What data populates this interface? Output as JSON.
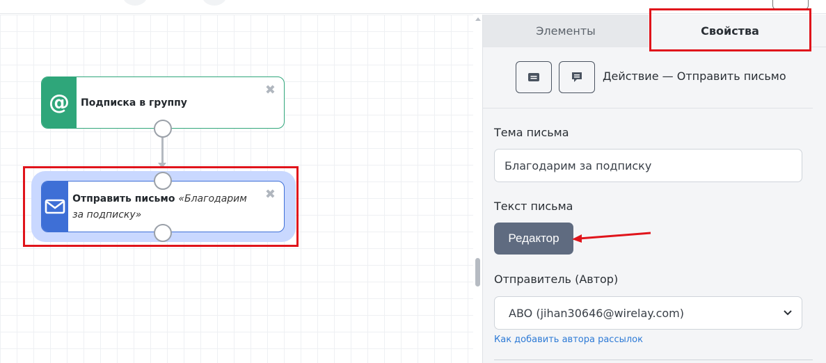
{
  "canvas": {
    "nodes": [
      {
        "label": "Подписка в группу",
        "icon": "at-icon",
        "color": "#2fa67a"
      },
      {
        "label": "Отправить письмо",
        "subtitle": "«Благодарим за подписку»",
        "icon": "envelope-icon",
        "color": "#3e6fd6",
        "selected": true
      }
    ],
    "close_glyph": "✖"
  },
  "panel": {
    "tabs": [
      {
        "label": "Элементы",
        "active": false
      },
      {
        "label": "Свойства",
        "active": true
      }
    ],
    "action_title": "Действие — Отправить письмо",
    "action_buttons": [
      "message-icon",
      "comment-icon"
    ],
    "subject": {
      "label": "Тема письма",
      "value": "Благодарим за подписку"
    },
    "body": {
      "label": "Текст письма",
      "editor_button": "Редактор"
    },
    "sender": {
      "label": "Отправитель (Автор)",
      "value": "ABO (jihan30646@wirelay.com)"
    },
    "help_link": "Как добавить автора рассылок"
  },
  "colors": {
    "highlight": "#e0141b",
    "selection": "#c9d8ff",
    "editor": "#5f6b80",
    "link": "#2d7ad6"
  }
}
